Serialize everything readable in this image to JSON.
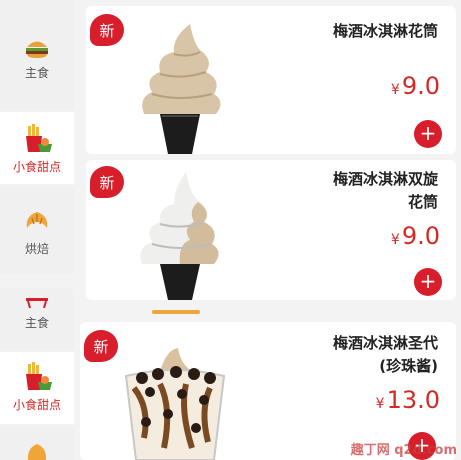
{
  "sidebar": {
    "items": [
      {
        "label": "主食",
        "icon": "burger-icon",
        "active": false
      },
      {
        "label": "小食甜点",
        "icon": "fries-icon",
        "active": true
      },
      {
        "label": "烘焙",
        "icon": "croissant-icon",
        "active": false
      },
      {
        "label": "主食",
        "icon": "burger-icon",
        "active": false
      },
      {
        "label": "小食甜点",
        "icon": "fries-icon",
        "active": true
      }
    ]
  },
  "products": [
    {
      "badge": "新",
      "name_lines": [
        "梅酒冰淇淋花筒"
      ],
      "currency": "¥",
      "price": "9.0"
    },
    {
      "badge": "新",
      "name_lines": [
        "梅酒冰淇淋双旋",
        "花筒"
      ],
      "currency": "¥",
      "price": "9.0"
    },
    {
      "badge": "新",
      "name_lines": [
        "梅酒冰淇淋圣代",
        "(珍珠酱)"
      ],
      "currency": "¥",
      "price": "13.0"
    }
  ],
  "add_label": "+",
  "watermark": "趣丁网 q2d.com",
  "colors": {
    "accent": "#d81e2a",
    "price": "#d42a27"
  }
}
